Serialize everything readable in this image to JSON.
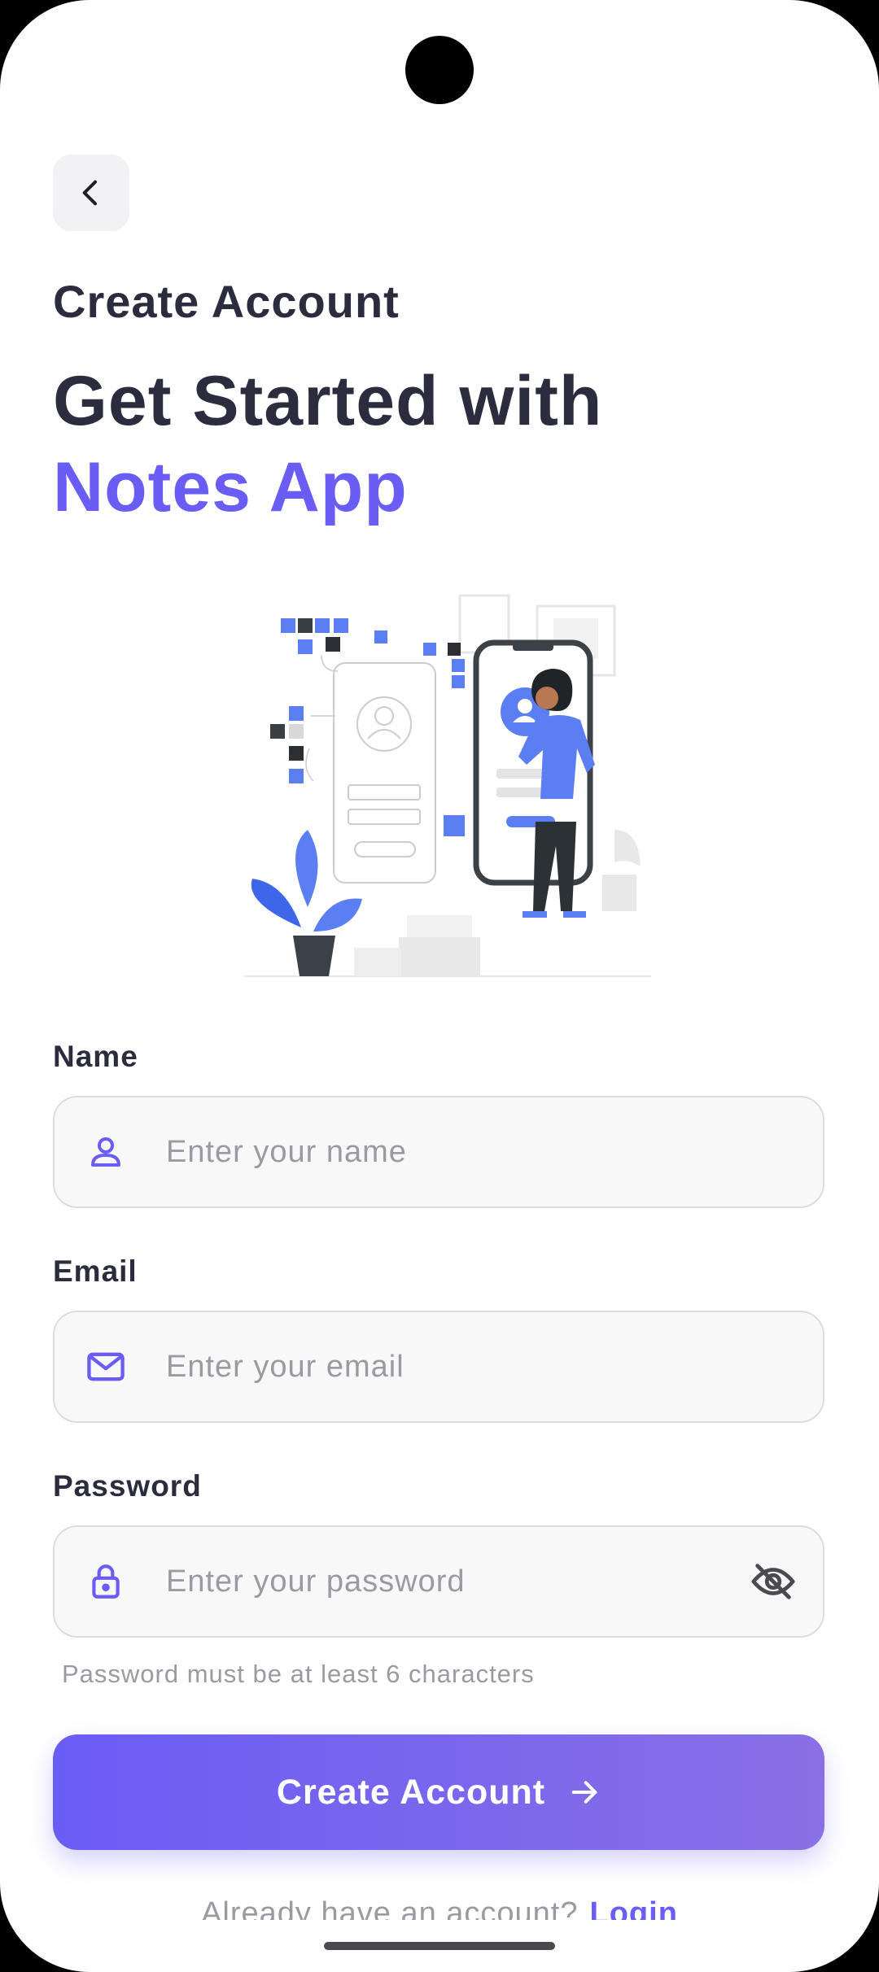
{
  "header": {
    "subtitle": "Create Account",
    "headline_line1": "Get Started with",
    "headline_line2": "Notes App"
  },
  "form": {
    "name": {
      "label": "Name",
      "placeholder": "Enter your name",
      "value": ""
    },
    "email": {
      "label": "Email",
      "placeholder": "Enter your email",
      "value": ""
    },
    "password": {
      "label": "Password",
      "placeholder": "Enter your password",
      "value": "",
      "hint": "Password must be at least 6 characters"
    },
    "submit_label": "Create Account"
  },
  "footer": {
    "prompt": "Already have an account?",
    "login_label": "Login"
  },
  "icons": {
    "back": "chevron-left-icon",
    "name": "user-icon",
    "email": "mail-icon",
    "password": "lock-icon",
    "toggle": "eye-off-icon",
    "submit": "arrow-right-icon"
  },
  "colors": {
    "accent": "#6a5df5",
    "text_dark": "#2b2d3e",
    "muted": "#9a9aa2",
    "field_bg": "#f8f8f9"
  }
}
